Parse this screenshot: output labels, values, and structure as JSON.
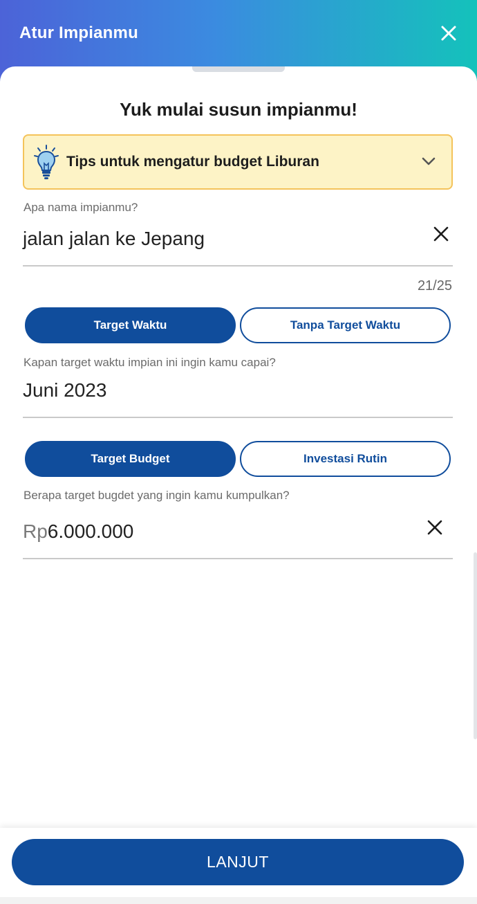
{
  "header": {
    "title": "Atur Impianmu"
  },
  "sheet": {
    "title": "Yuk mulai susun impianmu!"
  },
  "tips": {
    "text": "Tips untuk mengatur budget Liburan"
  },
  "dream_name": {
    "label": "Apa nama impianmu?",
    "value": "jalan jalan ke Jepang",
    "counter": "21/25"
  },
  "time_toggle": {
    "options": [
      "Target Waktu",
      "Tanpa Target Waktu"
    ],
    "selected": "Target Waktu"
  },
  "target_time": {
    "label": "Kapan target waktu impian ini ingin kamu capai?",
    "value": "Juni 2023"
  },
  "budget_toggle": {
    "options": [
      "Target Budget",
      "Investasi Rutin"
    ],
    "selected": "Target Budget"
  },
  "budget": {
    "label": "Berapa target bugdet yang ingin kamu kumpulkan?",
    "currency": "Rp",
    "value": "6.000.000"
  },
  "footer": {
    "primary_label": "LANJUT"
  },
  "colors": {
    "primary": "#104d9c",
    "tips_background": "#fdf3c6",
    "tips_border": "#f4c35a",
    "header_gradient_start": "#4c63d8",
    "header_gradient_end": "#14c2bb"
  }
}
